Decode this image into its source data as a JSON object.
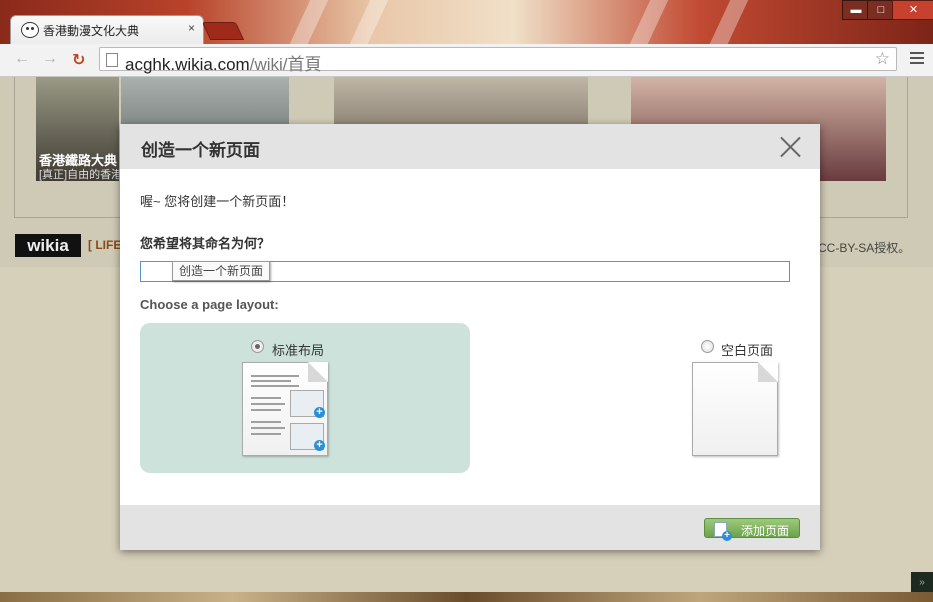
{
  "browser": {
    "tab_title": "香港動漫文化大典",
    "tab_close": "×",
    "url_host": "acghk.wikia.com",
    "url_path": "/wiki/首頁",
    "window_min": "▬",
    "window_max": "□",
    "window_close": "✕"
  },
  "page": {
    "thumb_caption": "香港鐵路大典",
    "thumb_subcaption": "[真正]自由的香港",
    "wikia_logo": "wikia",
    "life_link": "[ LIFE",
    "license_text": "CC-BY-SA授权。",
    "scroll_top": "»"
  },
  "modal": {
    "title": "创造一个新页面",
    "intro": "喔~ 您将创建一个新页面！",
    "question": "您希望将其命名为何？",
    "input_value": "",
    "tooltip": "创造一个新页面",
    "layout_label": "Choose a page layout:",
    "layouts": [
      {
        "label": "标准布局",
        "selected": true
      },
      {
        "label": "空白页面",
        "selected": false
      }
    ],
    "add_button": "添加页面"
  },
  "colors": {
    "selected_layout_bg": "#cee2dc",
    "add_button": "#7fb35d",
    "input_focus_border": "#5e8fd6"
  }
}
